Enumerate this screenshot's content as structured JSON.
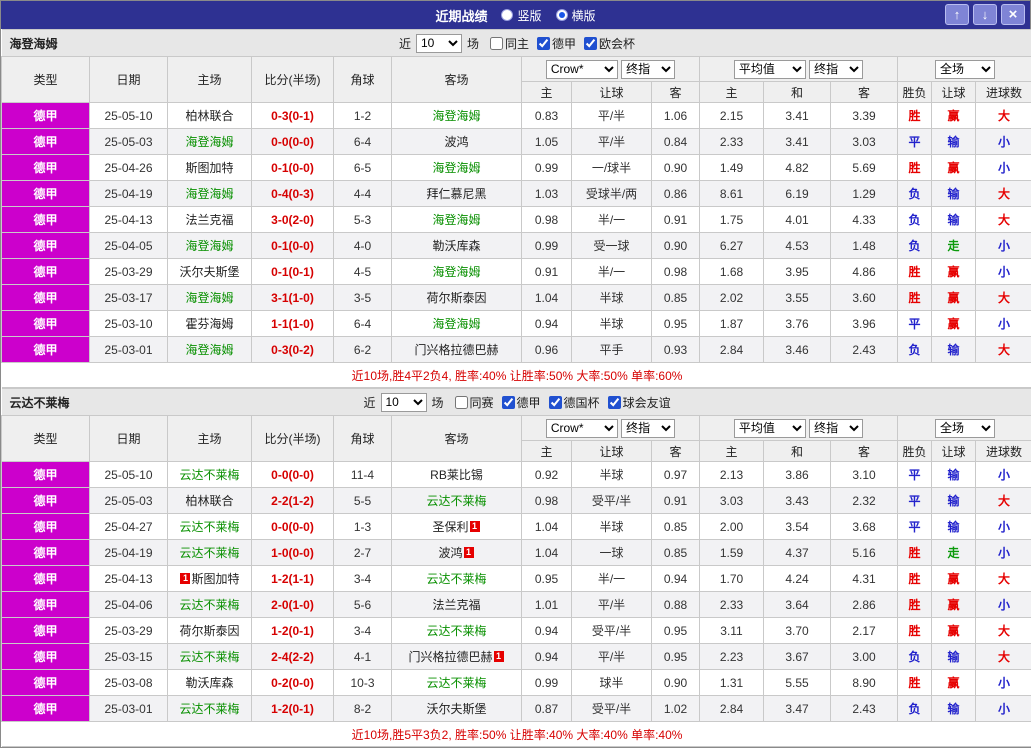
{
  "titlebar": {
    "title": "近期战绩",
    "vertical_label": "竖版",
    "horizontal_label": "横版",
    "up_icon": "↑",
    "down_icon": "↓",
    "close_icon": "×"
  },
  "controls": {
    "near": "近",
    "matches": "场"
  },
  "table_header": {
    "type": "类型",
    "date": "日期",
    "home": "主场",
    "score": "比分(半场)",
    "corners": "角球",
    "away": "客场",
    "crown_select": "Crow*",
    "final_index_select": "终指",
    "average_select": "平均值",
    "fullmatch_select": "全场",
    "crown_sub": [
      "主",
      "让球",
      "客"
    ],
    "avg_sub": [
      "主",
      "和",
      "客"
    ],
    "result_cols": [
      "胜负",
      "让球",
      "进球数"
    ]
  },
  "result_colors": {
    "胜": "#e60000",
    "平": "#2222cc",
    "负": "#2222cc",
    "赢": "#e60000",
    "输": "#2222cc",
    "走": "#0b9a0b",
    "大": "#e60000",
    "小": "#2222cc"
  },
  "colors": {
    "league_badge": "#cc00cc",
    "tracked_team": "#089000",
    "score": "#d60000",
    "titlebar": "#2e3192"
  },
  "sections": [
    {
      "team": "海登海姆",
      "near_count": "10",
      "filters": [
        {
          "label": "同主",
          "checked": false
        },
        {
          "label": "德甲",
          "checked": true
        },
        {
          "label": "欧会杯",
          "checked": true
        }
      ],
      "rows": [
        {
          "league": "德甲",
          "date": "25-05-10",
          "home": "柏林联合",
          "score": "0-3(0-1)",
          "corners": "1-2",
          "away": "海登海姆",
          "away_green": true,
          "crown": [
            "0.83",
            "平/半",
            "1.06"
          ],
          "avg": [
            "2.15",
            "3.41",
            "3.39"
          ],
          "results": [
            "胜",
            "赢",
            "大"
          ]
        },
        {
          "league": "德甲",
          "date": "25-05-03",
          "home": "海登海姆",
          "home_green": true,
          "score": "0-0(0-0)",
          "corners": "6-4",
          "away": "波鸿",
          "crown": [
            "1.05",
            "平/半",
            "0.84"
          ],
          "avg": [
            "2.33",
            "3.41",
            "3.03"
          ],
          "results": [
            "平",
            "输",
            "小"
          ]
        },
        {
          "league": "德甲",
          "date": "25-04-26",
          "home": "斯图加特",
          "score": "0-1(0-0)",
          "corners": "6-5",
          "away": "海登海姆",
          "away_green": true,
          "crown": [
            "0.99",
            "一/球半",
            "0.90"
          ],
          "avg": [
            "1.49",
            "4.82",
            "5.69"
          ],
          "results": [
            "胜",
            "赢",
            "小"
          ]
        },
        {
          "league": "德甲",
          "date": "25-04-19",
          "home": "海登海姆",
          "home_green": true,
          "score": "0-4(0-3)",
          "corners": "4-4",
          "away": "拜仁慕尼黑",
          "crown": [
            "1.03",
            "受球半/两",
            "0.86"
          ],
          "avg": [
            "8.61",
            "6.19",
            "1.29"
          ],
          "results": [
            "负",
            "输",
            "大"
          ]
        },
        {
          "league": "德甲",
          "date": "25-04-13",
          "home": "法兰克福",
          "score": "3-0(2-0)",
          "corners": "5-3",
          "away": "海登海姆",
          "away_green": true,
          "crown": [
            "0.98",
            "半/一",
            "0.91"
          ],
          "avg": [
            "1.75",
            "4.01",
            "4.33"
          ],
          "results": [
            "负",
            "输",
            "大"
          ]
        },
        {
          "league": "德甲",
          "date": "25-04-05",
          "home": "海登海姆",
          "home_green": true,
          "score": "0-1(0-0)",
          "corners": "4-0",
          "away": "勒沃库森",
          "crown": [
            "0.99",
            "受一球",
            "0.90"
          ],
          "avg": [
            "6.27",
            "4.53",
            "1.48"
          ],
          "results": [
            "负",
            "走",
            "小"
          ]
        },
        {
          "league": "德甲",
          "date": "25-03-29",
          "home": "沃尔夫斯堡",
          "score": "0-1(0-1)",
          "corners": "4-5",
          "away": "海登海姆",
          "away_green": true,
          "crown": [
            "0.91",
            "半/一",
            "0.98"
          ],
          "avg": [
            "1.68",
            "3.95",
            "4.86"
          ],
          "results": [
            "胜",
            "赢",
            "小"
          ]
        },
        {
          "league": "德甲",
          "date": "25-03-17",
          "home": "海登海姆",
          "home_green": true,
          "score": "3-1(1-0)",
          "corners": "3-5",
          "away": "荷尔斯泰因",
          "crown": [
            "1.04",
            "半球",
            "0.85"
          ],
          "avg": [
            "2.02",
            "3.55",
            "3.60"
          ],
          "results": [
            "胜",
            "赢",
            "大"
          ]
        },
        {
          "league": "德甲",
          "date": "25-03-10",
          "home": "霍芬海姆",
          "score": "1-1(1-0)",
          "corners": "6-4",
          "away": "海登海姆",
          "away_green": true,
          "crown": [
            "0.94",
            "半球",
            "0.95"
          ],
          "avg": [
            "1.87",
            "3.76",
            "3.96"
          ],
          "results": [
            "平",
            "赢",
            "小"
          ]
        },
        {
          "league": "德甲",
          "date": "25-03-01",
          "home": "海登海姆",
          "home_green": true,
          "score": "0-3(0-2)",
          "corners": "6-2",
          "away": "门兴格拉德巴赫",
          "crown": [
            "0.96",
            "平手",
            "0.93"
          ],
          "avg": [
            "2.84",
            "3.46",
            "2.43"
          ],
          "results": [
            "负",
            "输",
            "大"
          ]
        }
      ],
      "summary": "近10场,胜4平2负4, 胜率:40% 让胜率:50% 大率:50% 单率:60%"
    },
    {
      "team": "云达不莱梅",
      "near_count": "10",
      "filters": [
        {
          "label": "同赛",
          "checked": false
        },
        {
          "label": "德甲",
          "checked": true
        },
        {
          "label": "德国杯",
          "checked": true
        },
        {
          "label": "球会友谊",
          "checked": true
        }
      ],
      "rows": [
        {
          "league": "德甲",
          "date": "25-05-10",
          "home": "云达不莱梅",
          "home_green": true,
          "score": "0-0(0-0)",
          "corners": "11-4",
          "away": "RB莱比锡",
          "crown": [
            "0.92",
            "半球",
            "0.97"
          ],
          "avg": [
            "2.13",
            "3.86",
            "3.10"
          ],
          "results": [
            "平",
            "输",
            "小"
          ]
        },
        {
          "league": "德甲",
          "date": "25-05-03",
          "home": "柏林联合",
          "score": "2-2(1-2)",
          "corners": "5-5",
          "away": "云达不莱梅",
          "away_green": true,
          "crown": [
            "0.98",
            "受平/半",
            "0.91"
          ],
          "avg": [
            "3.03",
            "3.43",
            "2.32"
          ],
          "results": [
            "平",
            "输",
            "大"
          ]
        },
        {
          "league": "德甲",
          "date": "25-04-27",
          "home": "云达不莱梅",
          "home_green": true,
          "score": "0-0(0-0)",
          "corners": "1-3",
          "away": "圣保利",
          "away_badge": "1",
          "crown": [
            "1.04",
            "半球",
            "0.85"
          ],
          "avg": [
            "2.00",
            "3.54",
            "3.68"
          ],
          "results": [
            "平",
            "输",
            "小"
          ]
        },
        {
          "league": "德甲",
          "date": "25-04-19",
          "home": "云达不莱梅",
          "home_green": true,
          "score": "1-0(0-0)",
          "corners": "2-7",
          "away": "波鸿",
          "away_badge": "1",
          "crown": [
            "1.04",
            "一球",
            "0.85"
          ],
          "avg": [
            "1.59",
            "4.37",
            "5.16"
          ],
          "results": [
            "胜",
            "走",
            "小"
          ]
        },
        {
          "league": "德甲",
          "date": "25-04-13",
          "home": "斯图加特",
          "home_badge": "1",
          "home_badge_pos": "before",
          "score": "1-2(1-1)",
          "corners": "3-4",
          "away": "云达不莱梅",
          "away_green": true,
          "crown": [
            "0.95",
            "半/一",
            "0.94"
          ],
          "avg": [
            "1.70",
            "4.24",
            "4.31"
          ],
          "results": [
            "胜",
            "赢",
            "大"
          ]
        },
        {
          "league": "德甲",
          "date": "25-04-06",
          "home": "云达不莱梅",
          "home_green": true,
          "score": "2-0(1-0)",
          "corners": "5-6",
          "away": "法兰克福",
          "crown": [
            "1.01",
            "平/半",
            "0.88"
          ],
          "avg": [
            "2.33",
            "3.64",
            "2.86"
          ],
          "results": [
            "胜",
            "赢",
            "小"
          ]
        },
        {
          "league": "德甲",
          "date": "25-03-29",
          "home": "荷尔斯泰因",
          "score": "1-2(0-1)",
          "corners": "3-4",
          "away": "云达不莱梅",
          "away_green": true,
          "crown": [
            "0.94",
            "受平/半",
            "0.95"
          ],
          "avg": [
            "3.11",
            "3.70",
            "2.17"
          ],
          "results": [
            "胜",
            "赢",
            "大"
          ]
        },
        {
          "league": "德甲",
          "date": "25-03-15",
          "home": "云达不莱梅",
          "home_green": true,
          "score": "2-4(2-2)",
          "corners": "4-1",
          "away": "门兴格拉德巴赫",
          "away_badge": "1",
          "crown": [
            "0.94",
            "平/半",
            "0.95"
          ],
          "avg": [
            "2.23",
            "3.67",
            "3.00"
          ],
          "results": [
            "负",
            "输",
            "大"
          ]
        },
        {
          "league": "德甲",
          "date": "25-03-08",
          "home": "勒沃库森",
          "score": "0-2(0-0)",
          "corners": "10-3",
          "away": "云达不莱梅",
          "away_green": true,
          "crown": [
            "0.99",
            "球半",
            "0.90"
          ],
          "avg": [
            "1.31",
            "5.55",
            "8.90"
          ],
          "results": [
            "胜",
            "赢",
            "小"
          ]
        },
        {
          "league": "德甲",
          "date": "25-03-01",
          "home": "云达不莱梅",
          "home_green": true,
          "score": "1-2(0-1)",
          "corners": "8-2",
          "away": "沃尔夫斯堡",
          "crown": [
            "0.87",
            "受平/半",
            "1.02"
          ],
          "avg": [
            "2.84",
            "3.47",
            "2.43"
          ],
          "results": [
            "负",
            "输",
            "小"
          ]
        }
      ],
      "summary": "近10场,胜5平3负2, 胜率:50% 让胜率:40% 大率:40% 单率:40%"
    }
  ]
}
